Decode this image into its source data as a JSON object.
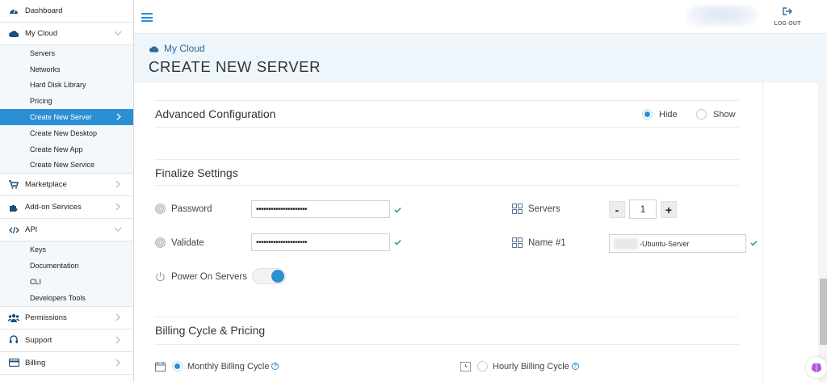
{
  "sidebar": {
    "dashboard": "Dashboard",
    "my_cloud": "My Cloud",
    "my_cloud_items": [
      "Servers",
      "Networks",
      "Hard Disk Library",
      "Pricing",
      "Create New Server",
      "Create New Desktop",
      "Create New App",
      "Create New Service"
    ],
    "marketplace": "Marketplace",
    "addon": "Add-on Services",
    "api": "API",
    "api_items": [
      "Keys",
      "Documentation",
      "CLI",
      "Developers Tools"
    ],
    "permissions": "Permissions",
    "support": "Support",
    "billing": "Billing"
  },
  "topbar": {
    "logout": "LOG OUT"
  },
  "header": {
    "breadcrumb": "My Cloud",
    "title": "CREATE NEW SERVER"
  },
  "advanced": {
    "title": "Advanced Configuration",
    "hide_label": "Hide",
    "show_label": "Show",
    "selected": "Hide"
  },
  "finalize": {
    "title": "Finalize Settings",
    "password_label": "Password",
    "password_value": "•••••••••••••••••••••",
    "validate_label": "Validate",
    "validate_value": "•••••••••••••••••••••",
    "power_label": "Power On Servers",
    "power_on": true,
    "servers_label": "Servers",
    "servers_minus": "-",
    "servers_value": "1",
    "servers_plus": "+",
    "name_label": "Name #1",
    "name_value": "-Ubuntu-Server"
  },
  "billing": {
    "title": "Billing Cycle & Pricing",
    "monthly": "Monthly Billing Cycle",
    "hourly": "Hourly Billing Cycle",
    "selected": "Monthly Billing Cycle",
    "help_glyph": "?"
  },
  "colors": {
    "accent": "#2b8fd3",
    "check": "#3aa655",
    "header_band": "#eef5fb",
    "submenu": "#f2f8fb"
  }
}
